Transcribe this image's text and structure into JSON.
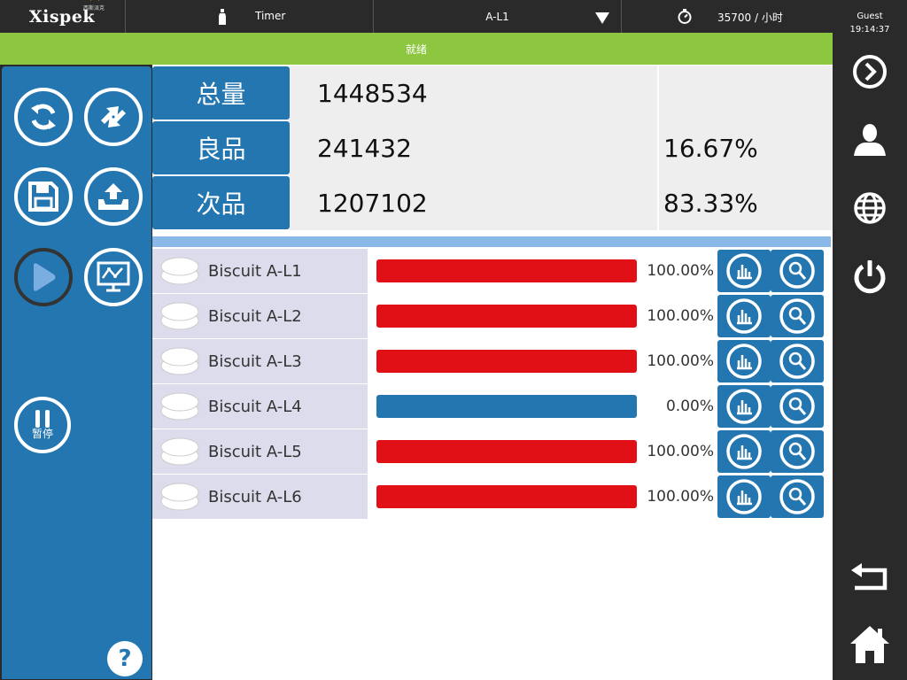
{
  "header": {
    "logo_text": "Xispek",
    "logo_sub": "西斯派克",
    "timer_label": "Timer",
    "line_name": "A-L1",
    "rate": "35700 / 小时"
  },
  "status": {
    "text": "就绪"
  },
  "user": {
    "name": "Guest",
    "time": "19:14:37"
  },
  "summary": {
    "total_label": "总量",
    "total_value": "1448534",
    "good_label": "良品",
    "good_value": "241432",
    "good_pct": "16.67%",
    "bad_label": "次品",
    "bad_value": "1207102",
    "bad_pct": "83.33%"
  },
  "left_panel": {
    "pause_label": "暂停",
    "help_label": "?"
  },
  "lines": [
    {
      "name": "Biscuit A-L1",
      "pct": "100.00%",
      "fill": 1.0,
      "status": "red"
    },
    {
      "name": "Biscuit A-L2",
      "pct": "100.00%",
      "fill": 1.0,
      "status": "red"
    },
    {
      "name": "Biscuit A-L3",
      "pct": "100.00%",
      "fill": 1.0,
      "status": "red"
    },
    {
      "name": "Biscuit A-L4",
      "pct": "0.00%",
      "fill": 0.0,
      "status": "blue"
    },
    {
      "name": "Biscuit A-L5",
      "pct": "100.00%",
      "fill": 1.0,
      "status": "red"
    },
    {
      "name": "Biscuit A-L6",
      "pct": "100.00%",
      "fill": 1.0,
      "status": "red"
    }
  ],
  "colors": {
    "accent_blue": "#2376b0",
    "status_green": "#8dc63f",
    "bar_red": "#e01016",
    "bar_blue": "#2376b0",
    "dark": "#2a2a2a"
  },
  "icons": {
    "left": [
      "refresh-icon",
      "swap-icon",
      "save-icon",
      "upload-icon",
      "play-icon",
      "trend-chart-icon",
      "pause-icon",
      "help-icon"
    ],
    "right": [
      "next-circle-icon",
      "user-icon",
      "globe-icon",
      "power-icon",
      "back-icon",
      "home-icon"
    ],
    "row": [
      "biscuit-icon",
      "bar-chart-icon",
      "search-detail-icon"
    ]
  }
}
